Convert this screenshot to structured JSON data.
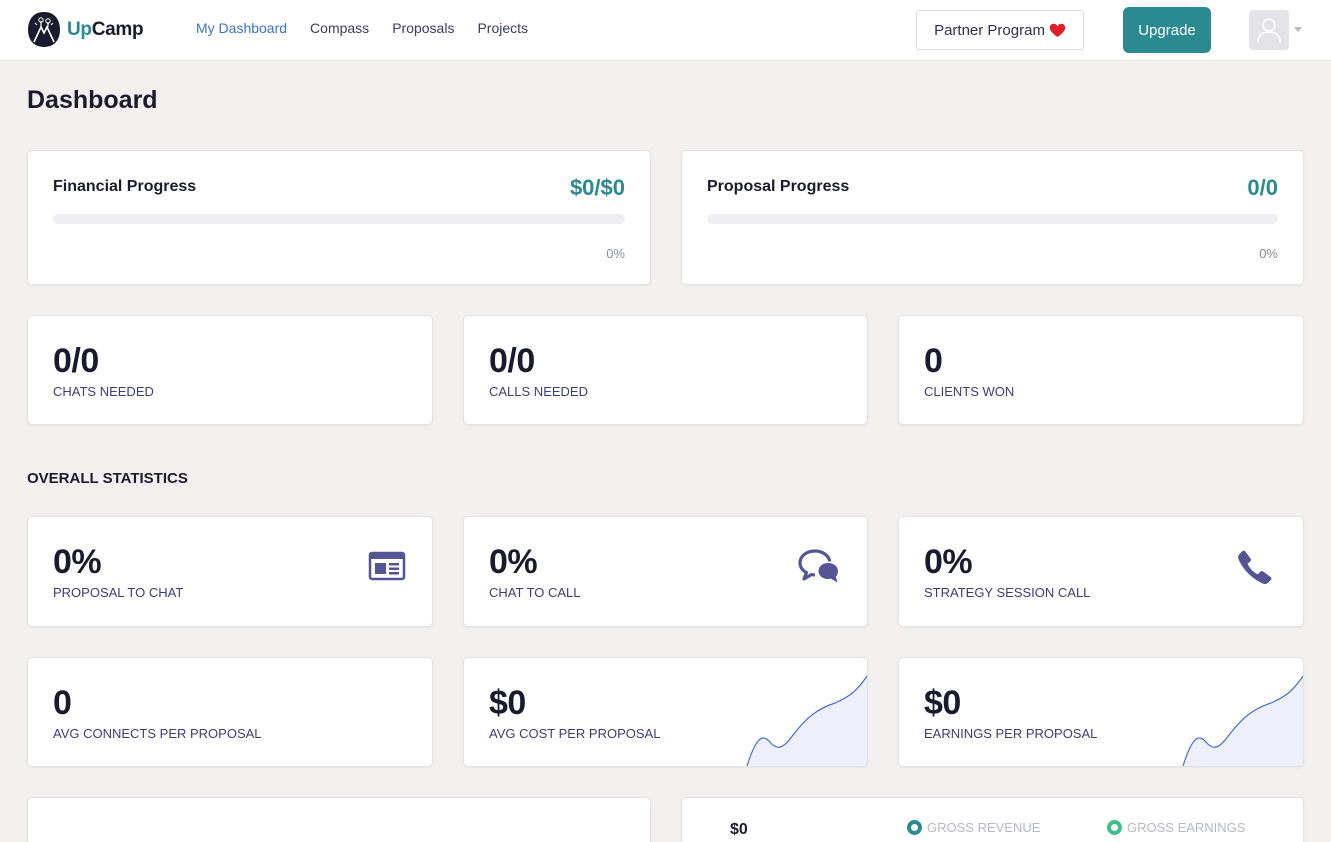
{
  "brand": {
    "name_a": "Up",
    "name_b": "Camp"
  },
  "nav": [
    {
      "label": "My Dashboard",
      "active": true
    },
    {
      "label": "Compass"
    },
    {
      "label": "Proposals"
    },
    {
      "label": "Projects"
    }
  ],
  "header": {
    "partner_label": "Partner Program",
    "upgrade_label": "Upgrade",
    "heart_icon": "heart-icon",
    "avatar_icon": "user-icon"
  },
  "page": {
    "title": "Dashboard"
  },
  "financial": {
    "title": "Financial Progress",
    "value": "$0/$0",
    "percent_label": "0%",
    "progress_fraction": 0
  },
  "proposal": {
    "title": "Proposal Progress",
    "value": "0/0",
    "percent_label": "0%",
    "progress_fraction": 0
  },
  "goals": [
    {
      "value": "0/0",
      "label": "CHATS NEEDED"
    },
    {
      "value": "0/0",
      "label": "CALLS NEEDED"
    },
    {
      "value": "0",
      "label": "CLIENTS WON"
    }
  ],
  "overall": {
    "title": "OVERALL STATISTICS",
    "rates": [
      {
        "value": "0%",
        "label": "PROPOSAL TO CHAT",
        "icon": "newspaper-icon"
      },
      {
        "value": "0%",
        "label": "CHAT TO CALL",
        "icon": "chat-bubbles-icon"
      },
      {
        "value": "0%",
        "label": "STRATEGY SESSION CALL",
        "icon": "phone-icon"
      }
    ],
    "metrics": [
      {
        "value": "0",
        "label": "AVG CONNECTS PER PROPOSAL"
      },
      {
        "value": "$0",
        "label": "AVG COST PER PROPOSAL"
      },
      {
        "value": "$0",
        "label": "EARNINGS PER PROPOSAL"
      }
    ]
  },
  "revenue": {
    "amount": "$0",
    "legend": [
      {
        "label": "GROSS REVENUE",
        "color": "#2b8a8f"
      },
      {
        "label": "GROSS EARNINGS",
        "color": "#3fbf8a"
      }
    ]
  },
  "colors": {
    "accent": "#2b8a8f",
    "nav_active": "#3b73d1",
    "label": "#3d3d78",
    "icon": "#555594",
    "spark_line": "#4a6fd1",
    "spark_fill": "#eef1fc"
  }
}
